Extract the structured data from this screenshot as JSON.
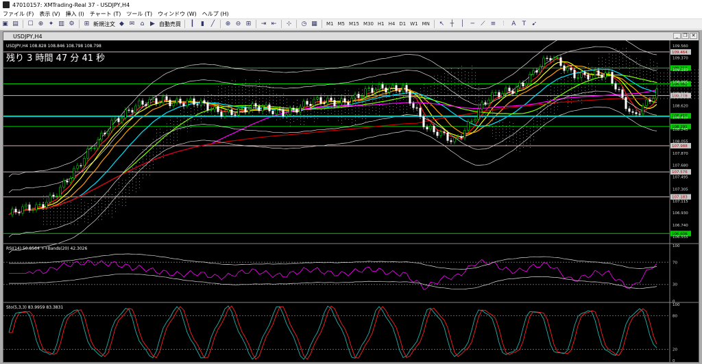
{
  "window_title": "47010157: XMTrading-Real 37 - USDJPY,H4",
  "menu": [
    "ファイル (F)",
    "表示 (V)",
    "挿入 (I)",
    "チャート (T)",
    "ツール (T)",
    "ウィンドウ (W)",
    "ヘルプ (H)"
  ],
  "toolbar": {
    "new_order": "新規注文",
    "auto_trade": "自動売買",
    "timeframes": [
      "M1",
      "M5",
      "M15",
      "M30",
      "H1",
      "H4",
      "D1",
      "W1",
      "MN"
    ]
  },
  "chart_window_title": "USDJPY,H4",
  "main_panel": {
    "info": "USDJPY,H4  108.828 108.846 108.798 108.798",
    "countdown": "残り 3 時間 47 分 41 秒",
    "price_scale": [
      "109.560",
      "109.370",
      "109.185",
      "108.995",
      "108.810",
      "108.620",
      "108.435",
      "108.245",
      "108.055",
      "107.870",
      "107.680",
      "107.495",
      "107.305",
      "107.115",
      "106.930",
      "106.740",
      "106.555"
    ],
    "level_labels": [
      {
        "price": "109.464",
        "kind": "white"
      },
      {
        "price": "109.211",
        "kind": "green"
      },
      {
        "price": "108.962",
        "kind": "green"
      },
      {
        "price": "108.778",
        "kind": "white"
      },
      {
        "price": "108.459",
        "kind": "green"
      },
      {
        "price": "108.291",
        "kind": "green"
      },
      {
        "price": "107.988",
        "kind": "white"
      },
      {
        "price": "107.576",
        "kind": "white"
      },
      {
        "price": "107.183",
        "kind": "white"
      },
      {
        "price": "106.606",
        "kind": "green"
      }
    ]
  },
  "rsi_panel": {
    "label": "RSI(14) 50.8564  ++Bands(20) 42.3026",
    "scale": [
      "100",
      "70",
      "30",
      "0"
    ]
  },
  "stoch_panel": {
    "label": "Sto(5,3,3) 83.9959 83.3831",
    "scale": [
      "100",
      "80",
      "20",
      "0"
    ]
  },
  "colors": {
    "background": "#000000",
    "bull": "#00ff00",
    "bear": "#ffffff",
    "level_green": "#00cc00",
    "level_white_label": "#c8c8c8",
    "level_line_white": "#d8b4b4",
    "sma_yellow": "#ffff00",
    "sma_red": "#ff1a1a",
    "sma_orange": "#ffa000",
    "sma_cyan": "#00e5ff",
    "sma_magenta": "#ff00ff",
    "sma_long_red": "#cc0000",
    "sma_green": "#7fff00",
    "bands": "#dddddd",
    "stoch_main": "#20b2aa",
    "stoch_signal": "#ff2020",
    "rsi_line": "#ff00ff"
  }
}
